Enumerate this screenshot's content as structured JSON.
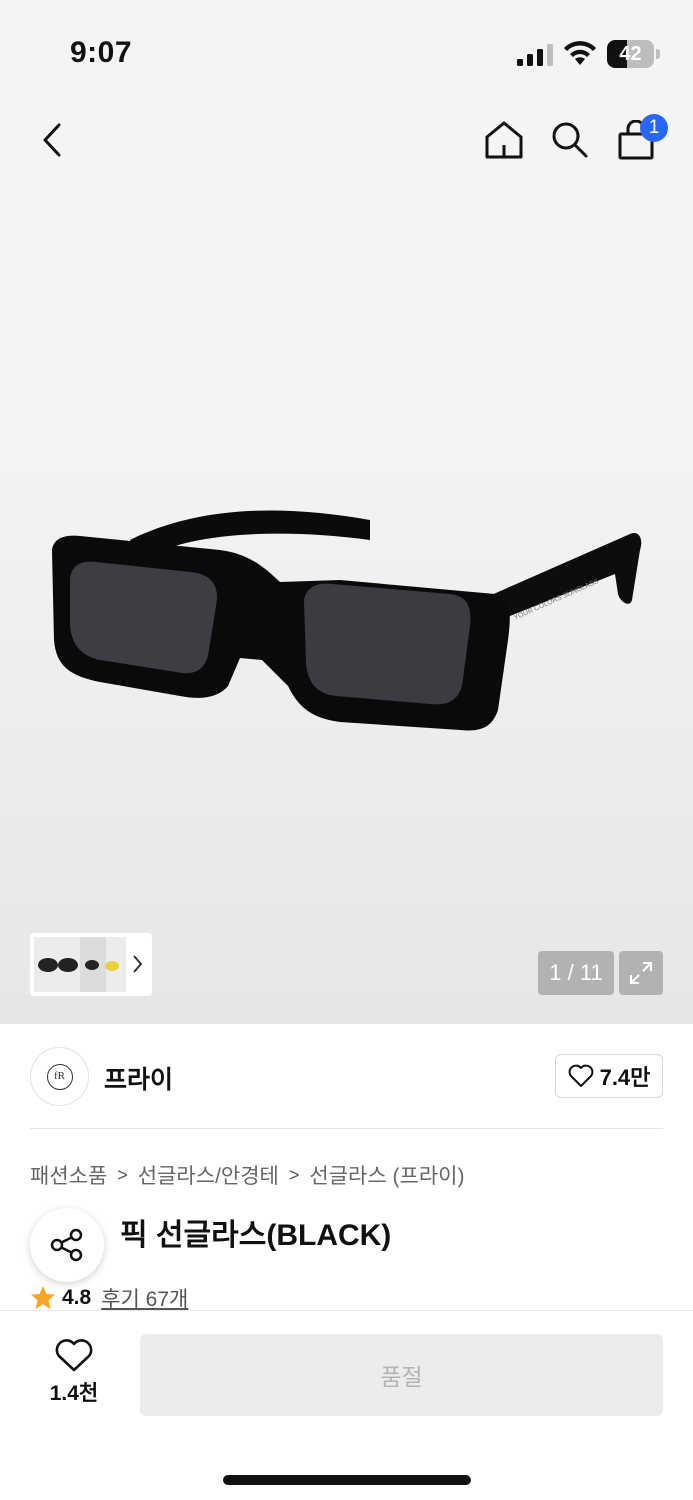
{
  "status_bar": {
    "time": "9:07",
    "battery": "42",
    "battery_level": 0.42
  },
  "header": {
    "cart_count": "1"
  },
  "gallery": {
    "pager": "1 / 11"
  },
  "brand": {
    "logo_text": "fR",
    "name": "프라이",
    "like_count": "7.4만"
  },
  "breadcrumb": [
    "패션소품",
    "선글라스/안경테",
    "선글라스 (프라이)"
  ],
  "product": {
    "title": "클래식 선글라스(BLACK)",
    "title_visible": "픽 선글라스(BLACK)"
  },
  "rating": {
    "score": "4.8",
    "review_label": "후기 67개"
  },
  "bottom_bar": {
    "wish_count": "1.4천",
    "buy_label": "품절"
  }
}
